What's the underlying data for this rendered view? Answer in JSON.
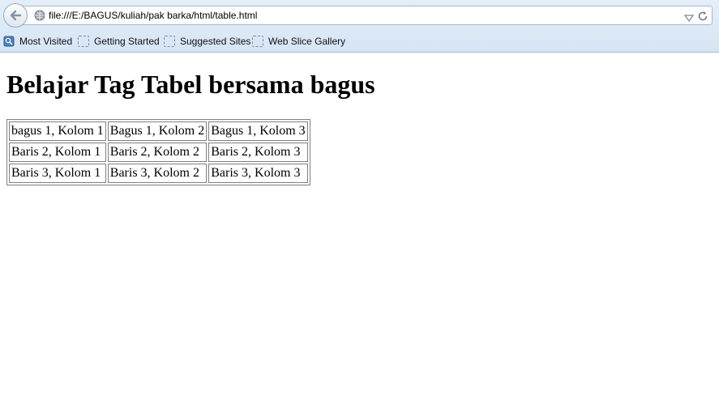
{
  "browser": {
    "url": "file:///E:/BAGUS/kuliah/pak barka/html/table.html",
    "bookmarks": [
      {
        "label": "Most Visited"
      },
      {
        "label": "Getting Started"
      },
      {
        "label": "Suggested Sites"
      },
      {
        "label": "Web Slice Gallery"
      }
    ]
  },
  "page": {
    "heading": "Belajar Tag Tabel bersama bagus",
    "table": {
      "rows": [
        [
          "bagus 1, Kolom 1",
          "Bagus 1, Kolom 2",
          "Bagus 1, Kolom 3"
        ],
        [
          "Baris 2, Kolom 1",
          "Baris 2, Kolom 2",
          "Baris 2, Kolom 3"
        ],
        [
          "Baris 3, Kolom 1",
          "Baris 3, Kolom 2",
          "Baris 3, Kolom 3"
        ]
      ]
    }
  },
  "colors": {
    "chrome_bg": "#d6e5f5",
    "border": "#808080"
  }
}
